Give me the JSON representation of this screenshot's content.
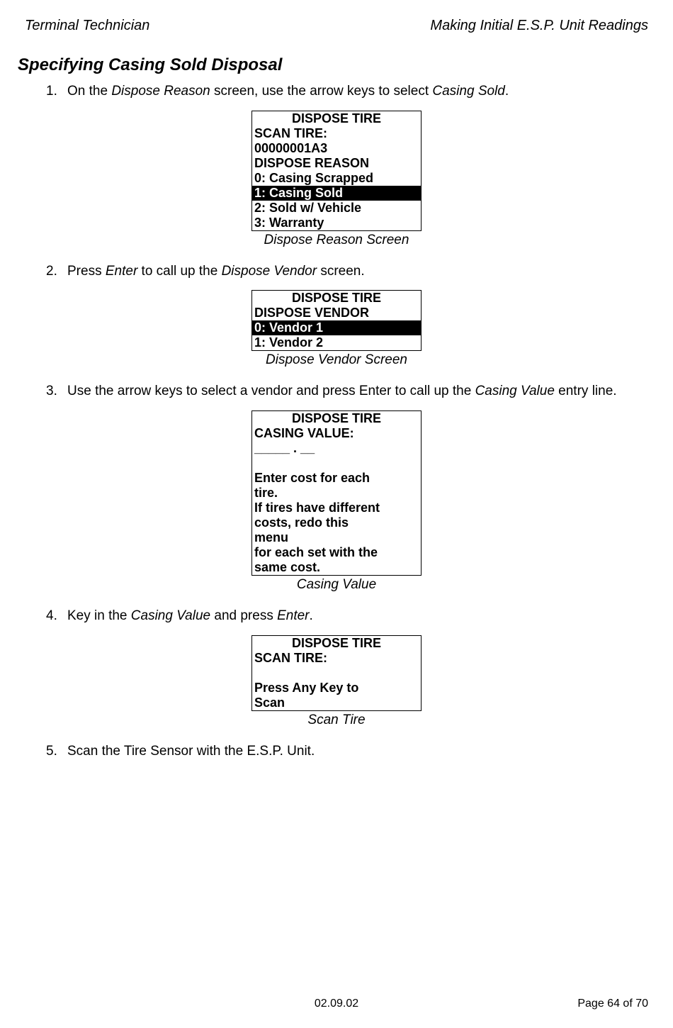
{
  "header": {
    "left": "Terminal Technician",
    "right": "Making Initial E.S.P. Unit Readings"
  },
  "section_title": "Specifying Casing Sold Disposal",
  "steps": {
    "s1": {
      "n": "1.",
      "prefix": "On the ",
      "i1": "Dispose Reason",
      "mid": " screen, use the arrow keys to select ",
      "i2": "Casing Sold",
      "suffix": "."
    },
    "s2": {
      "n": "2.",
      "prefix": "Press ",
      "i1": "Enter",
      "mid": " to call up the ",
      "i2": "Dispose Vendor",
      "suffix": " screen."
    },
    "s3": {
      "n": "3.",
      "prefix": "Use the arrow keys to select a vendor and press Enter to call up the ",
      "i1": "Casing Value",
      "suffix": " entry line."
    },
    "s4": {
      "n": "4.",
      "prefix": "Key in the ",
      "i1": "Casing Value",
      "mid": " and press ",
      "i2": "Enter",
      "suffix": "."
    },
    "s5": {
      "n": "5.",
      "text": "Scan the Tire Sensor with the E.S.P. Unit."
    }
  },
  "screens": {
    "reason": {
      "title": "DISPOSE TIRE",
      "lines": {
        "l1": "SCAN TIRE:",
        "l2": "00000001A3",
        "l3": "DISPOSE REASON",
        "l4": "0: Casing Scrapped",
        "l5": "1: Casing Sold",
        "l6": "2: Sold w/ Vehicle",
        "l7": "3: Warranty"
      },
      "caption": "Dispose Reason Screen"
    },
    "vendor": {
      "title": "DISPOSE TIRE",
      "lines": {
        "l1": "DISPOSE VENDOR",
        "l2": "0: Vendor 1",
        "l3": "1: Vendor 2"
      },
      "caption": "Dispose Vendor Screen"
    },
    "casing": {
      "title": "DISPOSE TIRE",
      "lines": {
        "l1": "CASING VALUE:",
        "l2": "_____ . __",
        "l3": " ",
        "l4": "Enter cost for each",
        "l5": "tire.",
        "l6": "If tires have different",
        "l7": "costs, redo this",
        "l8": "menu",
        "l9": "for each set with the",
        "l10": "same cost."
      },
      "caption": "Casing Value"
    },
    "scan": {
      "title": "DISPOSE TIRE",
      "lines": {
        "l1": "SCAN TIRE:",
        "l2": " ",
        "l3": "Press Any Key to",
        "l4": "Scan"
      },
      "caption": "Scan Tire"
    }
  },
  "footer": {
    "date": "02.09.02",
    "page": "Page 64 of 70"
  }
}
